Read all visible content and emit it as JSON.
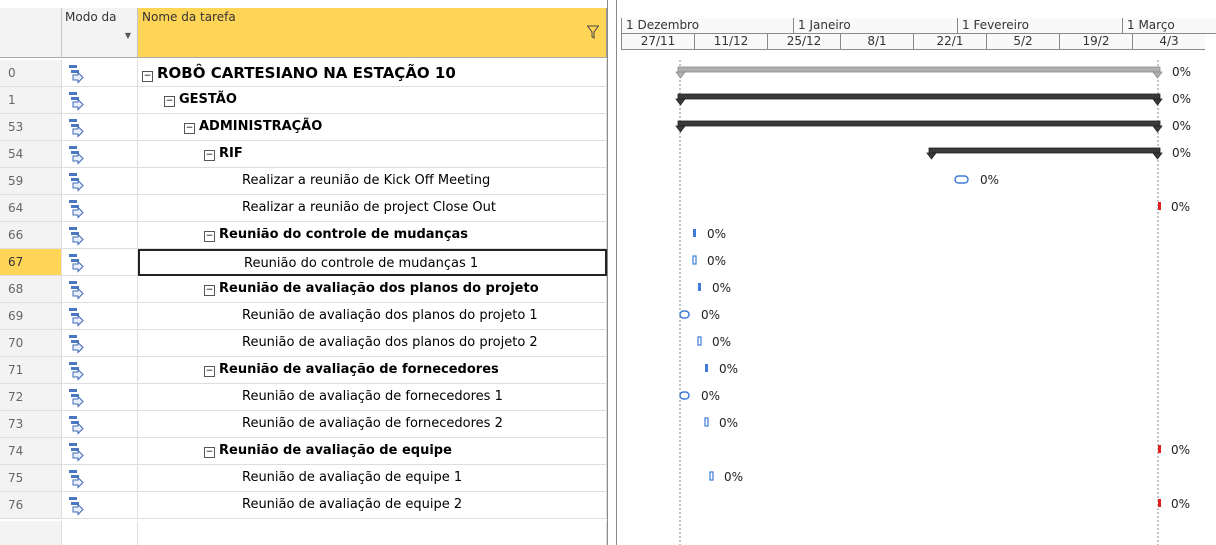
{
  "header": {
    "mode_label": "Modo da",
    "name_label": "Nome da tarefa",
    "filter_icon": "funnel-icon",
    "dropdown_icon": "triangle-down-icon"
  },
  "timeline": {
    "top": [
      "1 Dezembro",
      "1 Janeiro",
      "1 Fevereiro",
      "1 Março"
    ],
    "bottom": [
      "27/11",
      "11/12",
      "25/12",
      "8/1",
      "22/1",
      "5/2",
      "19/2",
      "4/3"
    ]
  },
  "tasks": [
    {
      "id": "0",
      "name": "ROBÔ CARTESIANO NA ESTAÇÃO 10",
      "level": 0,
      "summary": true,
      "pct": "0%"
    },
    {
      "id": "1",
      "name": "GESTÃO",
      "level": 1,
      "summary": true,
      "pct": "0%"
    },
    {
      "id": "53",
      "name": "ADMINISTRAÇÃO",
      "level": 2,
      "summary": true,
      "pct": "0%"
    },
    {
      "id": "54",
      "name": "RIF",
      "level": 3,
      "summary": true,
      "pct": "0%"
    },
    {
      "id": "59",
      "name": "Realizar a reunião de Kick Off Meeting",
      "level": 4,
      "summary": false,
      "pct": "0%"
    },
    {
      "id": "64",
      "name": "Realizar a reunião de project Close Out",
      "level": 4,
      "summary": false,
      "pct": "0%"
    },
    {
      "id": "66",
      "name": "Reunião do controle de mudanças",
      "level": 3,
      "summary": true,
      "pct": "0%"
    },
    {
      "id": "67",
      "name": "Reunião do controle de mudanças  1",
      "level": 4,
      "summary": false,
      "pct": "0%",
      "selected": true
    },
    {
      "id": "68",
      "name": "Reunião de avaliação dos planos do projeto",
      "level": 3,
      "summary": true,
      "pct": "0%"
    },
    {
      "id": "69",
      "name": "Reunião de avaliação dos planos do projeto 1",
      "level": 4,
      "summary": false,
      "pct": "0%"
    },
    {
      "id": "70",
      "name": "Reunião de avaliação dos planos do projeto 2",
      "level": 4,
      "summary": false,
      "pct": "0%"
    },
    {
      "id": "71",
      "name": "Reunião de avaliação de fornecedores",
      "level": 3,
      "summary": true,
      "pct": "0%"
    },
    {
      "id": "72",
      "name": "Reunião de avaliação de fornecedores 1",
      "level": 4,
      "summary": false,
      "pct": "0%"
    },
    {
      "id": "73",
      "name": "Reunião de avaliação de fornecedores  2",
      "level": 4,
      "summary": false,
      "pct": "0%"
    },
    {
      "id": "74",
      "name": "Reunião de avaliação de equipe",
      "level": 3,
      "summary": true,
      "pct": "0%"
    },
    {
      "id": "75",
      "name": "Reunião de avaliação de equipe 1",
      "level": 4,
      "summary": false,
      "pct": "0%"
    },
    {
      "id": "76",
      "name": "Reunião de avaliação de equipe 2",
      "level": 4,
      "summary": false,
      "pct": "0%"
    }
  ],
  "colors": {
    "header_selected": "#ffd558",
    "task_mode_icon": "#4a76c2",
    "milestone_blue": "#3f7bd8",
    "late_red": "#e02020",
    "summary_bar": "#3a3a3a",
    "project_summary_bar": "#b0b0b0"
  },
  "mode_icon_name": "auto-scheduled-task-icon"
}
